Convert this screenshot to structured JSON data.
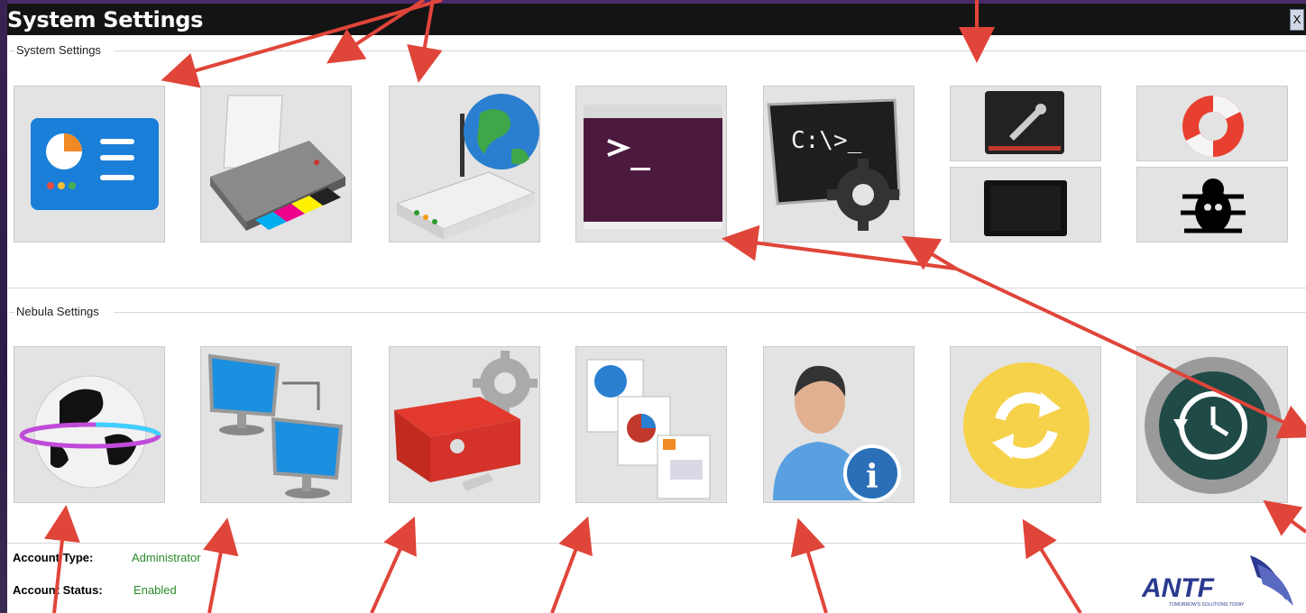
{
  "window": {
    "title": "System Settings",
    "close_label": "X"
  },
  "system_group": {
    "label": "System Settings",
    "tiles": [
      {
        "icon": "control-panel-icon"
      },
      {
        "icon": "printer-icon"
      },
      {
        "icon": "network-router-icon"
      },
      {
        "icon": "terminal-icon"
      },
      {
        "icon": "command-prompt-settings-icon"
      },
      {
        "icon": "tools-tablet-icon"
      },
      {
        "icon": "help-lifebuoy-icon"
      },
      {
        "icon": "tablet-device-icon"
      },
      {
        "icon": "bug-debug-icon"
      }
    ]
  },
  "nebula_group": {
    "label": "Nebula Settings",
    "tiles": [
      {
        "icon": "globe-internet-icon"
      },
      {
        "icon": "network-computers-icon"
      },
      {
        "icon": "toolbox-settings-icon"
      },
      {
        "icon": "documents-web-icon"
      },
      {
        "icon": "user-info-icon"
      },
      {
        "icon": "sync-refresh-icon"
      },
      {
        "icon": "time-machine-backup-icon"
      }
    ]
  },
  "account": {
    "type_label": "Account Type:",
    "type_value": "Administrator",
    "status_label": "Account Status:",
    "status_value": "Enabled"
  },
  "logo": {
    "text": "ANTF",
    "tagline": "TOMORROW'S SOLUTIONS TODAY"
  },
  "colors": {
    "titlebar": "#141414",
    "tile": "#e3e3e3",
    "account_value": "#2a8a2a",
    "annotation_arrow": "#e0453a",
    "logo": "#2b3a8f"
  }
}
